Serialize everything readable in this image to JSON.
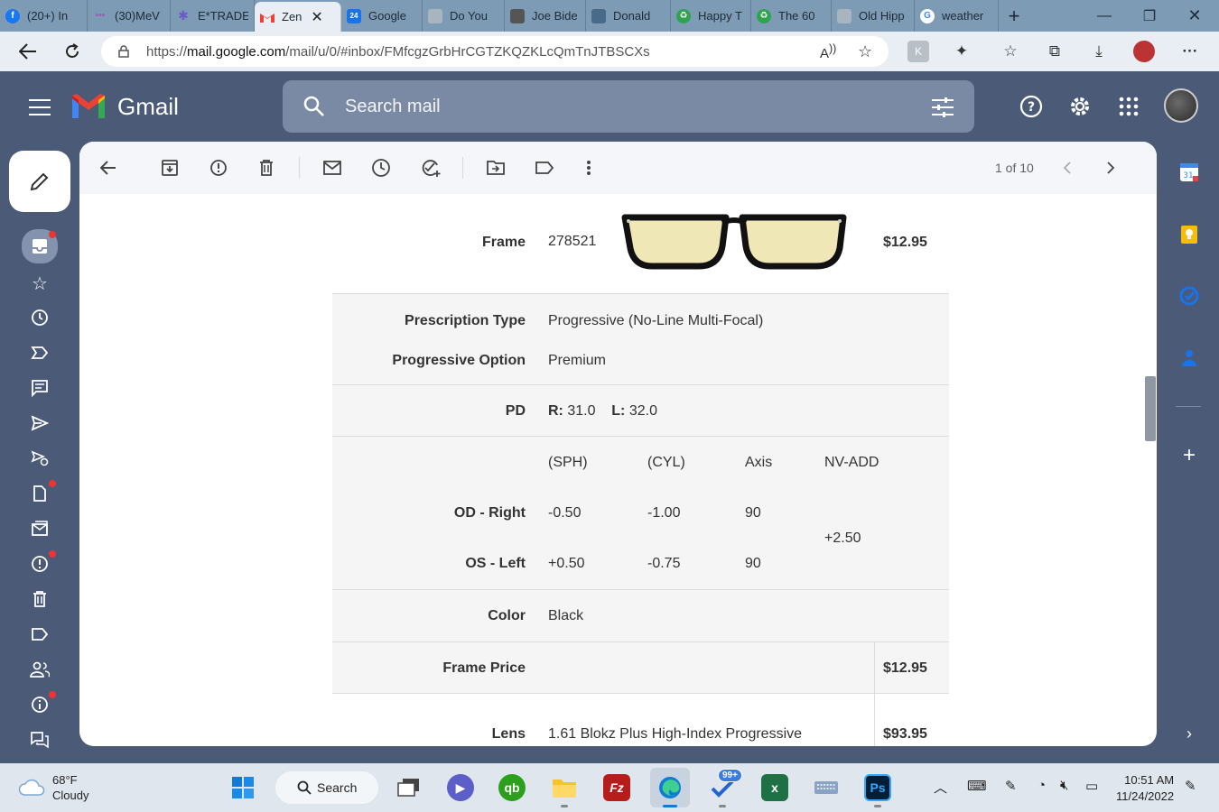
{
  "browser": {
    "tabs": [
      {
        "label": "(20+) In",
        "favicon_color": "#1877f2",
        "favicon_glyph": "f"
      },
      {
        "label": "(30)MeV",
        "favicon_color": "#9b59b6",
        "favicon_glyph": "•"
      },
      {
        "label": "E*TRADE",
        "favicon_color": "#6a5acd",
        "favicon_glyph": "✱"
      },
      {
        "label": "Zen",
        "favicon_color": "#ea4335",
        "favicon_glyph": "M",
        "active": true
      },
      {
        "label": "Google",
        "favicon_color": "#1a73e8",
        "favicon_glyph": "24"
      },
      {
        "label": "Do You",
        "favicon_color": "#8a9aa8",
        "favicon_glyph": "◐"
      },
      {
        "label": "Joe Bide",
        "favicon_color": "#555",
        "favicon_glyph": "▪"
      },
      {
        "label": "Donald",
        "favicon_color": "#4a6a8a",
        "favicon_glyph": "▪"
      },
      {
        "label": "Happy T",
        "favicon_color": "#2ea44f",
        "favicon_glyph": "♻"
      },
      {
        "label": "The 60",
        "favicon_color": "#2ea44f",
        "favicon_glyph": "♻"
      },
      {
        "label": "Old Hipp",
        "favicon_color": "#8a9aa8",
        "favicon_glyph": "◐"
      },
      {
        "label": "weather",
        "favicon_color": "#4285f4",
        "favicon_glyph": "G"
      }
    ],
    "url_prefix": "https://",
    "url_domain": "mail.google.com",
    "url_path": "/mail/u/0/#inbox/FMfcgzGrbHrCGTZKQZKLcQmTnJTBSCXs"
  },
  "gmail": {
    "logo_text": "Gmail",
    "search_placeholder": "Search mail",
    "pager": "1 of 10"
  },
  "email": {
    "frame_label": "Frame",
    "frame_code": "278521",
    "frame_price": "$12.95",
    "prescription_type_label": "Prescription Type",
    "prescription_type": "Progressive (No-Line Multi-Focal)",
    "progressive_option_label": "Progressive Option",
    "progressive_option": "Premium",
    "pd_label": "PD",
    "pd_r_label": "R:",
    "pd_r": "31.0",
    "pd_l_label": "L:",
    "pd_l": "32.0",
    "rx_headers": [
      "(SPH)",
      "(CYL)",
      "Axis",
      "NV-ADD"
    ],
    "od_label": "OD - Right",
    "od": {
      "sph": "-0.50",
      "cyl": "-1.00",
      "axis": "90"
    },
    "os_label": "OS - Left",
    "os": {
      "sph": "+0.50",
      "cyl": "-0.75",
      "axis": "90"
    },
    "nv_add": "+2.50",
    "color_label": "Color",
    "color": "Black",
    "frame_price_label": "Frame Price",
    "frame_price_total": "$12.95",
    "lens_label": "Lens",
    "lens": "1.61 Blokz Plus High-Index Progressive",
    "lens_price": "$93.95"
  },
  "taskbar": {
    "temp": "68°F",
    "condition": "Cloudy",
    "search_label": "Search",
    "badge": "99+",
    "time": "10:51 AM",
    "date": "11/24/2022"
  }
}
